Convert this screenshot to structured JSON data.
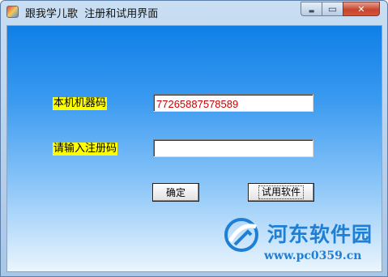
{
  "window": {
    "title": "跟我学儿歌  注册和试用界面",
    "min_glyph": "▬",
    "max_glyph": "▭",
    "close_glyph": "✕"
  },
  "form": {
    "machine_code_label": "本机机器码",
    "machine_code_value": "77265887578589",
    "register_code_label": "请输入注册码",
    "register_code_value": "",
    "ok_button": "确定",
    "trial_button": "试用软件"
  },
  "watermark": {
    "brand": "河东软件园",
    "url": "www.pc0359.cn"
  },
  "colors": {
    "label_bg": "#ffff00",
    "machine_code_text": "#cc0000",
    "watermark": "#1f7fd4"
  }
}
